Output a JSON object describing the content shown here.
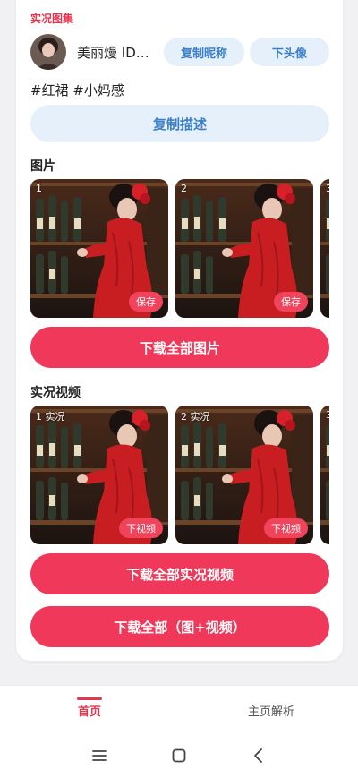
{
  "header": {
    "section_tag": "实况图集"
  },
  "user": {
    "nickname": "美丽熳 ID…",
    "copy_name_label": "复制昵称",
    "download_avatar_label": "下头像"
  },
  "description": {
    "tags": "#红裙 #小妈感",
    "copy_label": "复制描述"
  },
  "images": {
    "title": "图片",
    "items": [
      {
        "index": "1",
        "action_label": "保存"
      },
      {
        "index": "2",
        "action_label": "保存"
      },
      {
        "index": "3"
      }
    ],
    "download_all_label": "下载全部图片"
  },
  "videos": {
    "title": "实况视频",
    "items": [
      {
        "index": "1 实况",
        "action_label": "下视频"
      },
      {
        "index": "2 实况",
        "action_label": "下视频"
      },
      {
        "index": "3"
      }
    ],
    "download_all_label": "下载全部实况视频"
  },
  "download_everything_label": "下载全部（图+视频）",
  "tabbar": {
    "tabs": [
      {
        "label": "首页",
        "active": true
      },
      {
        "label": "主页解析",
        "active": false
      }
    ]
  },
  "system_nav": {
    "icons": [
      "menu-icon",
      "home-icon",
      "back-icon"
    ]
  },
  "colors": {
    "accent": "#f0395a",
    "tag": "#e8344e",
    "pill_bg": "#e5f0fb",
    "pill_text": "#3a7fc9"
  }
}
